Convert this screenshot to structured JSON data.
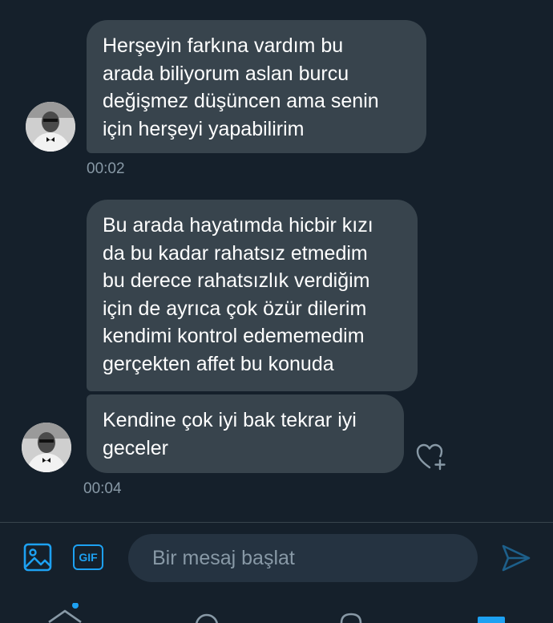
{
  "messages": [
    {
      "text": "Herşeyin farkına vardım bu\narada biliyorum aslan burcu\ndeğişmez düşüncen ama senin\niçin herşeyi yapabilirim",
      "time": "00:02"
    },
    {
      "text": "Bu arada hayatımda hicbir kızı\nda bu kadar rahatsız etmedim\nbu derece rahatsızlık verdiğim\niçin de ayrıca çok özür dilerim\nkendimi kontrol edememedim\ngerçekten affet bu konuda"
    },
    {
      "text": "Kendine çok iyi bak tekrar iyi\ngeceler",
      "time": "00:04"
    }
  ],
  "composer": {
    "gif_label": "GIF",
    "placeholder": "Bir mesaj başlat"
  },
  "icons": {
    "image": "image-icon",
    "gif": "gif-icon",
    "send": "send-icon",
    "like": "heart-plus-icon",
    "tabs": [
      "home-icon",
      "search-icon",
      "notifications-icon",
      "messages-icon"
    ]
  },
  "colors": {
    "background": "#15202b",
    "bubble": "#38444d",
    "accent": "#1da1f2",
    "muted": "#8899a6",
    "input": "#253341"
  }
}
